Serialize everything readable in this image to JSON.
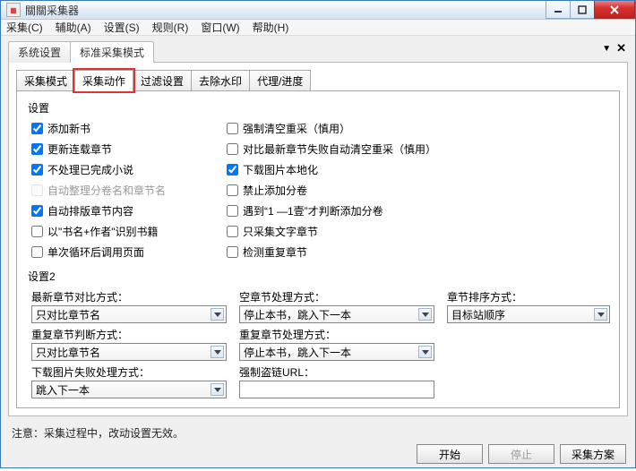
{
  "window": {
    "title": "關關采集器"
  },
  "menu": {
    "collect": "采集(C)",
    "assist": "辅助(A)",
    "settings": "设置(S)",
    "rules": "规则(R)",
    "window": "窗口(W)",
    "help": "帮助(H)"
  },
  "outer_tabs": {
    "system": "系统设置",
    "standard": "标准采集模式"
  },
  "inner_tabs": {
    "mode": "采集模式",
    "action": "采集动作",
    "filter": "过滤设置",
    "watermark": "去除水印",
    "proxy": "代理/进度"
  },
  "section1": {
    "title": "设置",
    "left": {
      "add_new": "添加新书",
      "update_serial": "更新连载章节",
      "skip_finished": "不处理已完成小说",
      "auto_sort": "自动整理分卷名和章节名",
      "auto_typeset": "自动排版章节内容",
      "name_author": "以\"书名+作者\"识别书籍",
      "single_loop": "单次循环后调用页面"
    },
    "right": {
      "force_clear": "强制清空重采（慎用）",
      "compare_fail": "对比最新章节失败自动清空重采（慎用）",
      "download_img": "下载图片本地化",
      "forbid_vol": "禁止添加分卷",
      "one_to_one": "遇到“1 —1壹”才判断添加分卷",
      "text_only": "只采集文字章节",
      "detect_dup": "检测重复章节"
    }
  },
  "section2": {
    "title": "设置2",
    "latest_compare_label": "最新章节对比方式：",
    "latest_compare_value": "只对比章节名",
    "empty_chapter_label": "空章节处理方式：",
    "empty_chapter_value": "停止本书，跳入下一本",
    "sort_label": "章节排序方式：",
    "sort_value": "目标站顺序",
    "dup_judge_label": "重复章节判断方式：",
    "dup_judge_value": "只对比章节名",
    "dup_handle_label": "重复章节处理方式：",
    "dup_handle_value": "停止本书，跳入下一本",
    "img_fail_label": "下载图片失败处理方式：",
    "img_fail_value": "跳入下一本",
    "force_url_label": "强制盗链URL："
  },
  "note": "注意：采集过程中，改动设置无效。",
  "buttons": {
    "start": "开始",
    "stop": "停止",
    "scheme": "采集方案"
  }
}
